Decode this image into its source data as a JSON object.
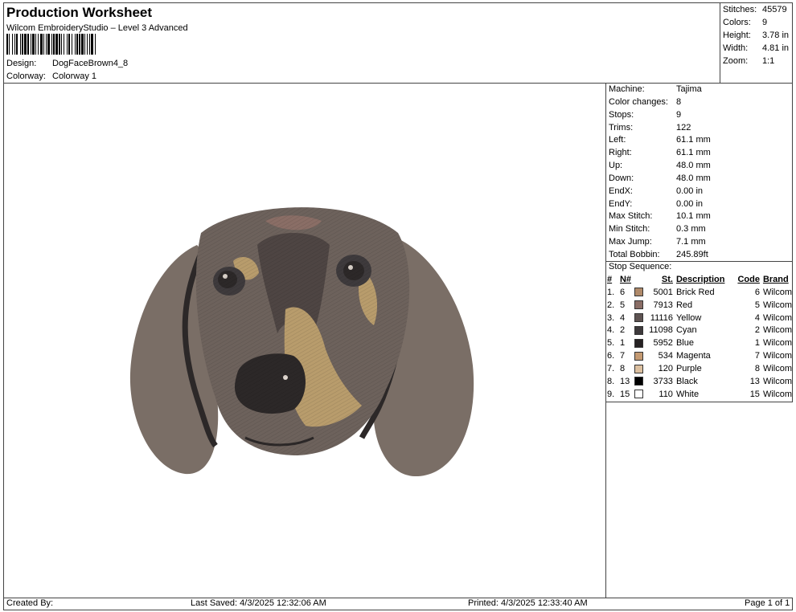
{
  "header": {
    "title": "Production Worksheet",
    "subtitle": "Wilcom EmbroideryStudio – Level 3 Advanced",
    "design_label": "Design:",
    "design_value": "DogFaceBrown4_8",
    "colorway_label": "Colorway:",
    "colorway_value": "Colorway 1"
  },
  "summary": [
    {
      "label": "Stitches:",
      "value": "45579"
    },
    {
      "label": "Colors:",
      "value": "9"
    },
    {
      "label": "Height:",
      "value": "3.78 in"
    },
    {
      "label": "Width:",
      "value": "4.81 in"
    },
    {
      "label": "Zoom:",
      "value": "1:1"
    }
  ],
  "specs": [
    {
      "label": "Machine:",
      "value": "Tajima"
    },
    {
      "label": "Color changes:",
      "value": "8"
    },
    {
      "label": "Stops:",
      "value": "9"
    },
    {
      "label": "Trims:",
      "value": "122"
    },
    {
      "label": "Left:",
      "value": "61.1 mm"
    },
    {
      "label": "Right:",
      "value": "61.1 mm"
    },
    {
      "label": "Up:",
      "value": "48.0 mm"
    },
    {
      "label": "Down:",
      "value": "48.0 mm"
    },
    {
      "label": "EndX:",
      "value": "0.00 in"
    },
    {
      "label": "EndY:",
      "value": "0.00 in"
    },
    {
      "label": "Max Stitch:",
      "value": "10.1 mm"
    },
    {
      "label": "Min Stitch:",
      "value": "0.3 mm"
    },
    {
      "label": "Max Jump:",
      "value": "7.1 mm"
    },
    {
      "label": "Total Bobbin:",
      "value": "245.89ft"
    }
  ],
  "stop_sequence": {
    "label": "Stop Sequence:",
    "headers": {
      "num": "#",
      "n": "N#",
      "st": "St.",
      "desc": "Description",
      "code": "Code",
      "brand": "Brand"
    },
    "rows": [
      {
        "num": "1.",
        "n": "6",
        "color": "#b08a6a",
        "st": "5001",
        "desc": "Brick Red",
        "code": "6",
        "brand": "Wilcom"
      },
      {
        "num": "2.",
        "n": "5",
        "color": "#8a6e66",
        "st": "7913",
        "desc": "Red",
        "code": "5",
        "brand": "Wilcom"
      },
      {
        "num": "3.",
        "n": "4",
        "color": "#5e5352",
        "st": "11116",
        "desc": "Yellow",
        "code": "4",
        "brand": "Wilcom"
      },
      {
        "num": "4.",
        "n": "2",
        "color": "#3e3a3c",
        "st": "11098",
        "desc": "Cyan",
        "code": "2",
        "brand": "Wilcom"
      },
      {
        "num": "5.",
        "n": "1",
        "color": "#262223",
        "st": "5952",
        "desc": "Blue",
        "code": "1",
        "brand": "Wilcom"
      },
      {
        "num": "6.",
        "n": "7",
        "color": "#c49a72",
        "st": "534",
        "desc": "Magenta",
        "code": "7",
        "brand": "Wilcom"
      },
      {
        "num": "7.",
        "n": "8",
        "color": "#dcc0a0",
        "st": "120",
        "desc": "Purple",
        "code": "8",
        "brand": "Wilcom"
      },
      {
        "num": "8.",
        "n": "13",
        "color": "#000000",
        "st": "3733",
        "desc": "Black",
        "code": "13",
        "brand": "Wilcom"
      },
      {
        "num": "9.",
        "n": "15",
        "color": "#ffffff",
        "st": "110",
        "desc": "White",
        "code": "15",
        "brand": "Wilcom"
      }
    ]
  },
  "footer": {
    "created_by": "Created By:",
    "last_saved": "Last Saved: 4/3/2025 12:32:06 AM",
    "printed": "Printed: 4/3/2025 12:33:40 AM",
    "page": "Page 1 of 1"
  },
  "design_colors": {
    "fur_dark": "#4e4543",
    "fur_mid": "#6d625c",
    "fur_tan": "#b89c6c",
    "ear": "#7a6e66",
    "nose": "#2c2828"
  }
}
